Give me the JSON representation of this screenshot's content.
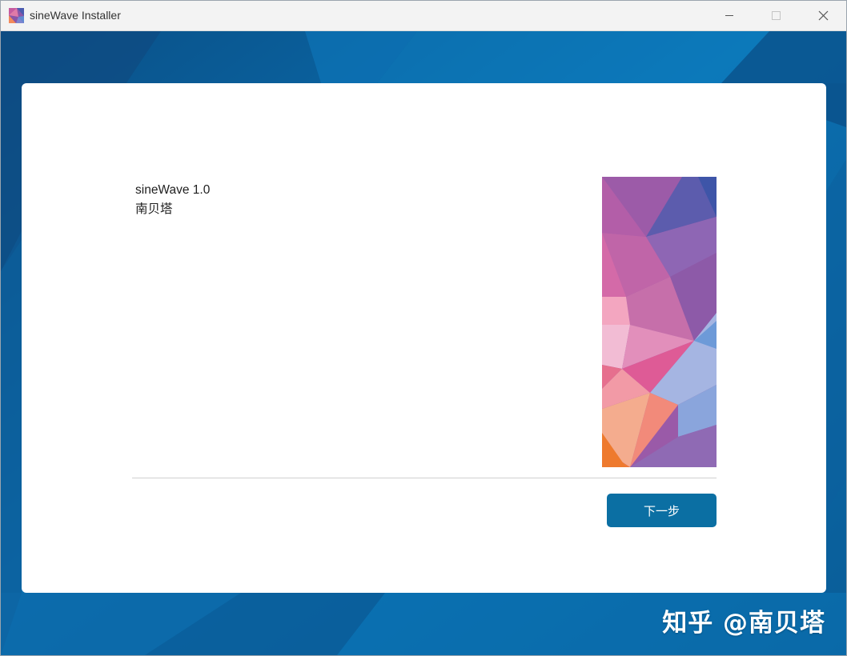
{
  "window": {
    "title": "sineWave Installer"
  },
  "content": {
    "product_name": "sineWave 1.0",
    "publisher": "南贝塔"
  },
  "footer": {
    "next_label": "下一步"
  },
  "watermark": {
    "text": "知乎 @南贝塔"
  },
  "icons": {
    "app": "app-icon",
    "minimize": "minimize-icon",
    "maximize": "maximize-icon",
    "close": "close-icon"
  },
  "colors": {
    "accent": "#0b6fa3",
    "background": "#0a63a0",
    "panel": "#ffffff"
  }
}
